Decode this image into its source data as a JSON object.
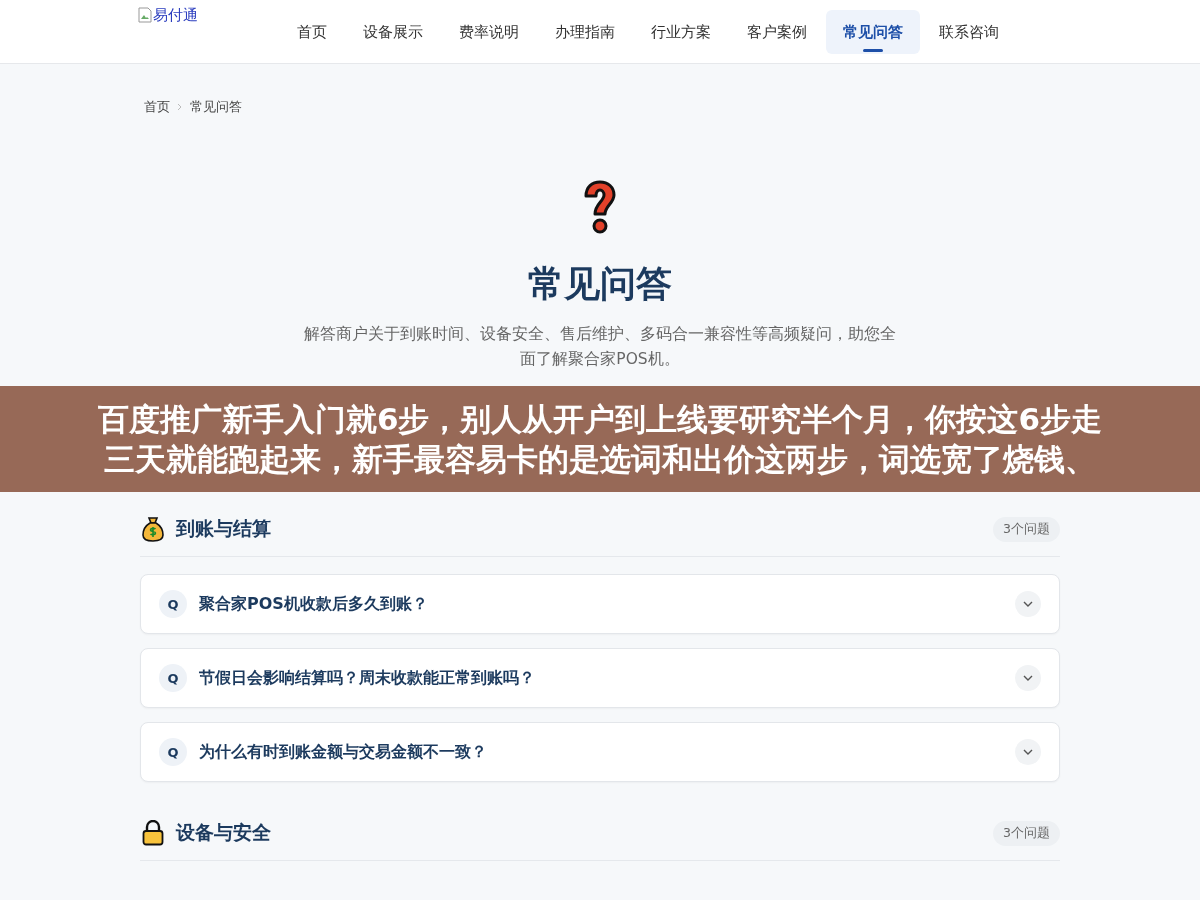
{
  "header": {
    "logo_alt": "易付通",
    "nav": [
      {
        "label": "首页",
        "selected": false
      },
      {
        "label": "设备展示",
        "selected": false
      },
      {
        "label": "费率说明",
        "selected": false
      },
      {
        "label": "办理指南",
        "selected": false
      },
      {
        "label": "行业方案",
        "selected": false
      },
      {
        "label": "客户案例",
        "selected": false
      },
      {
        "label": "常见问答",
        "selected": true
      },
      {
        "label": "联系咨询",
        "selected": false
      }
    ]
  },
  "breadcrumb": [
    "首页",
    "常见问答"
  ],
  "hero": {
    "title": "常见问答",
    "description": "解答商户关于到账时间、设备安全、售后维护、多码合一兼容性等高频疑问，助您全面了解聚合家POS机。"
  },
  "overlay_banner": {
    "lines": [
      "百度推广新手入门就6步，别人从开户到上线要研究半个月，你按这6步走",
      "三天就能跑起来，新手最容易卡的是选词和出价这两步，词选宽了烧钱、"
    ]
  },
  "sections": [
    {
      "kind": "money",
      "title": "到账与结算",
      "count": "3个问题",
      "questions": [
        {
          "badge": "Q",
          "text": "聚合家POS机收款后多久到账？",
          "expanded": false
        },
        {
          "badge": "Q",
          "text": "节假日会影响结算吗？周末收款能正常到账吗？",
          "expanded": false
        },
        {
          "badge": "Q",
          "text": "为什么有时到账金额与交易金额不一致？",
          "expanded": false
        }
      ]
    },
    {
      "kind": "lock",
      "title": "设备与安全",
      "count": "3个问题"
    }
  ]
}
